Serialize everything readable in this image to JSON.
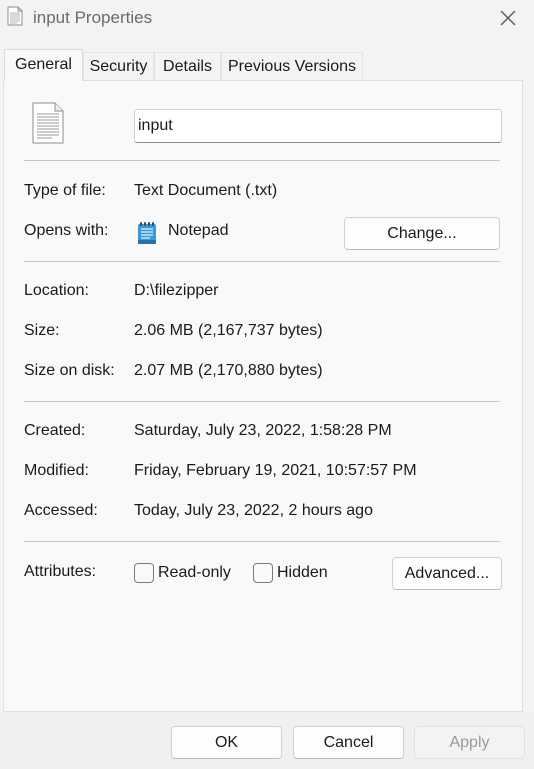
{
  "window": {
    "title": "input Properties"
  },
  "tabs": [
    {
      "label": "General"
    },
    {
      "label": "Security"
    },
    {
      "label": "Details"
    },
    {
      "label": "Previous Versions"
    }
  ],
  "file": {
    "name": "input"
  },
  "type_row": {
    "label": "Type of file:",
    "value": "Text Document (.txt)"
  },
  "opens_row": {
    "label": "Opens with:",
    "app": "Notepad",
    "change_label": "Change..."
  },
  "location_row": {
    "label": "Location:",
    "value": "D:\\filezipper"
  },
  "size_row": {
    "label": "Size:",
    "value": "2.06 MB (2,167,737 bytes)"
  },
  "size_on_disk_row": {
    "label": "Size on disk:",
    "value": "2.07 MB (2,170,880 bytes)"
  },
  "created_row": {
    "label": "Created:",
    "value": "Saturday, July 23, 2022, 1:58:28 PM"
  },
  "modified_row": {
    "label": "Modified:",
    "value": "Friday, February 19, 2021, 10:57:57 PM"
  },
  "accessed_row": {
    "label": "Accessed:",
    "value": "Today, July 23, 2022, 2 hours ago"
  },
  "attributes": {
    "label": "Attributes:",
    "readonly_label": "Read-only",
    "readonly_checked": false,
    "hidden_label": "Hidden",
    "hidden_checked": false,
    "advanced_label": "Advanced..."
  },
  "footer": {
    "ok_label": "OK",
    "cancel_label": "Cancel",
    "apply_label": "Apply"
  },
  "icons": {
    "title": "text-file-icon",
    "close": "close-icon",
    "file": "text-document-icon",
    "app": "notepad-icon"
  },
  "colors": {
    "background": "#f3f3f3",
    "panel": "#f9f9f9",
    "accent_notepad": "#3a9ad9"
  }
}
